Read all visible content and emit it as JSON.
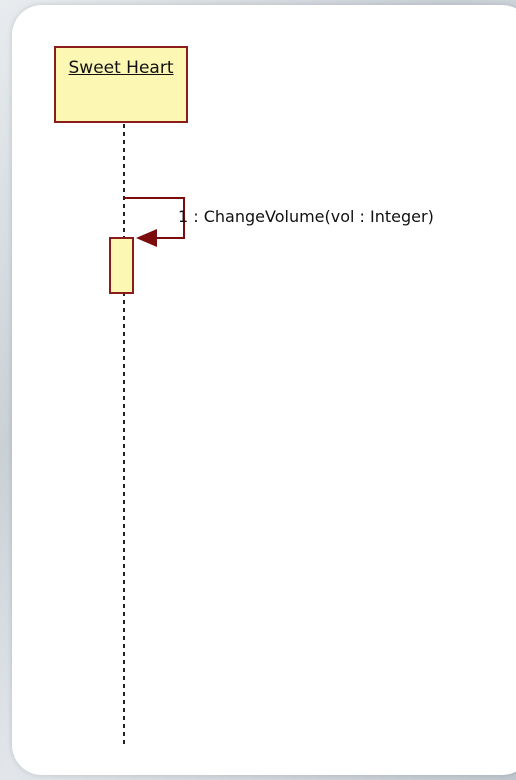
{
  "lifeline": {
    "name": "Sweet Heart"
  },
  "messages": [
    {
      "label": "1 : ChangeVolume(vol : Integer)",
      "type": "self-call"
    }
  ],
  "colors": {
    "border": "#8b1c1c",
    "fill": "#fdf7b4",
    "arrow": "#7a0c0c",
    "lifeline": "#222222",
    "canvas": "#ffffff"
  }
}
